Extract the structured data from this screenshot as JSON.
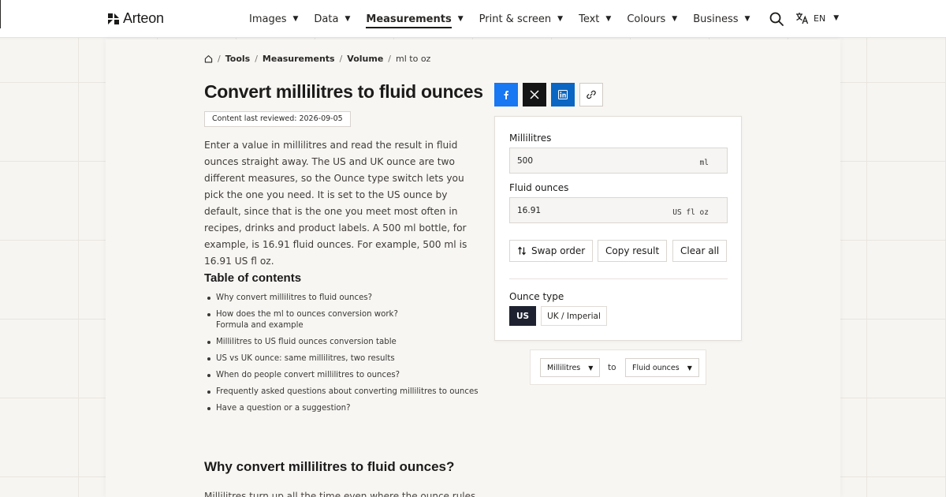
{
  "brand": {
    "name": "Arteon"
  },
  "nav": {
    "items": [
      {
        "label": "Images"
      },
      {
        "label": "Data"
      },
      {
        "label": "Measurements",
        "active": true
      },
      {
        "label": "Print & screen"
      },
      {
        "label": "Text"
      },
      {
        "label": "Colours"
      },
      {
        "label": "Business"
      }
    ],
    "language": "EN"
  },
  "breadcrumb": {
    "items": [
      "Tools",
      "Measurements",
      "Volume"
    ],
    "current": "ml to oz"
  },
  "page": {
    "title": "Convert millilitres to fluid ounces",
    "reviewed": "Content last reviewed: 2026-09-05",
    "intro": "Enter a value in millilitres and read the result in fluid ounces straight away. The US and UK ounce are two different measures, so the Ounce type switch lets you pick the one you need. It is set to the US ounce by default, since that is the one you meet most often in recipes, drinks and product labels. A 500 ml bottle, for example, is 16.91 fluid ounces. For example, 500 ml is 16.91 US fl oz."
  },
  "toc": {
    "title": "Table of contents",
    "items": [
      "Why convert millilitres to fluid ounces?",
      "How does the ml to ounces conversion work? Formula and example",
      "Millilitres to US fluid ounces conversion table",
      "US vs UK ounce: same millilitres, two results",
      "When do people convert millilitres to ounces?",
      "Frequently asked questions about converting millilitres to ounces",
      "Have a question or a suggestion?"
    ]
  },
  "section": {
    "title": "Why convert millilitres to fluid ounces?",
    "text_start": "Millilitres turn up all the time even where the ounce rules"
  },
  "converter": {
    "from_label": "Millilitres",
    "from_value": "500",
    "from_unit": "ml",
    "to_label": "Fluid ounces",
    "to_value": "16.91",
    "to_unit": "US fl oz",
    "swap_label": "Swap order",
    "copy_label": "Copy result",
    "clear_label": "Clear all",
    "ounce_type_label": "Ounce type",
    "ounce_options": [
      "US",
      "UK / Imperial"
    ],
    "ounce_selected": "US"
  },
  "unit_selector": {
    "from": "Millilitres",
    "connector": "to",
    "to": "Fluid ounces"
  },
  "colors": {
    "facebook": "#1877f2",
    "x": "#151515",
    "linkedin": "#0a66c2",
    "selected_segment": "#1e2230"
  }
}
